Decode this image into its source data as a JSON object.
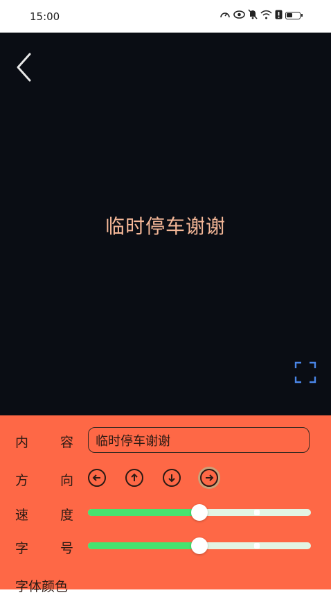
{
  "status_bar": {
    "time": "15:00",
    "icons": [
      "speedometer-icon",
      "eye-icon",
      "bell-off-icon",
      "wifi-icon",
      "alert-icon",
      "battery-icon"
    ]
  },
  "preview": {
    "text": "临时停车谢谢",
    "background_color": "#0a0d14",
    "text_color": "#f5b898",
    "back_icon": "chevron-left-icon",
    "fullscreen_icon": "fullscreen-icon"
  },
  "panel": {
    "background_color": "#fe6846",
    "content": {
      "label_1": "内",
      "label_2": "容",
      "value": "临时停车谢谢"
    },
    "direction": {
      "label_1": "方",
      "label_2": "向",
      "buttons": [
        "arrow-left-icon",
        "arrow-up-icon",
        "arrow-down-icon",
        "arrow-right-icon"
      ],
      "selected": "right"
    },
    "speed": {
      "label_1": "速",
      "label_2": "度",
      "value_fraction": 0.5
    },
    "font_size": {
      "label_1": "字",
      "label_2": "号",
      "value_fraction": 0.5
    },
    "font_color_label": "字体颜色"
  }
}
